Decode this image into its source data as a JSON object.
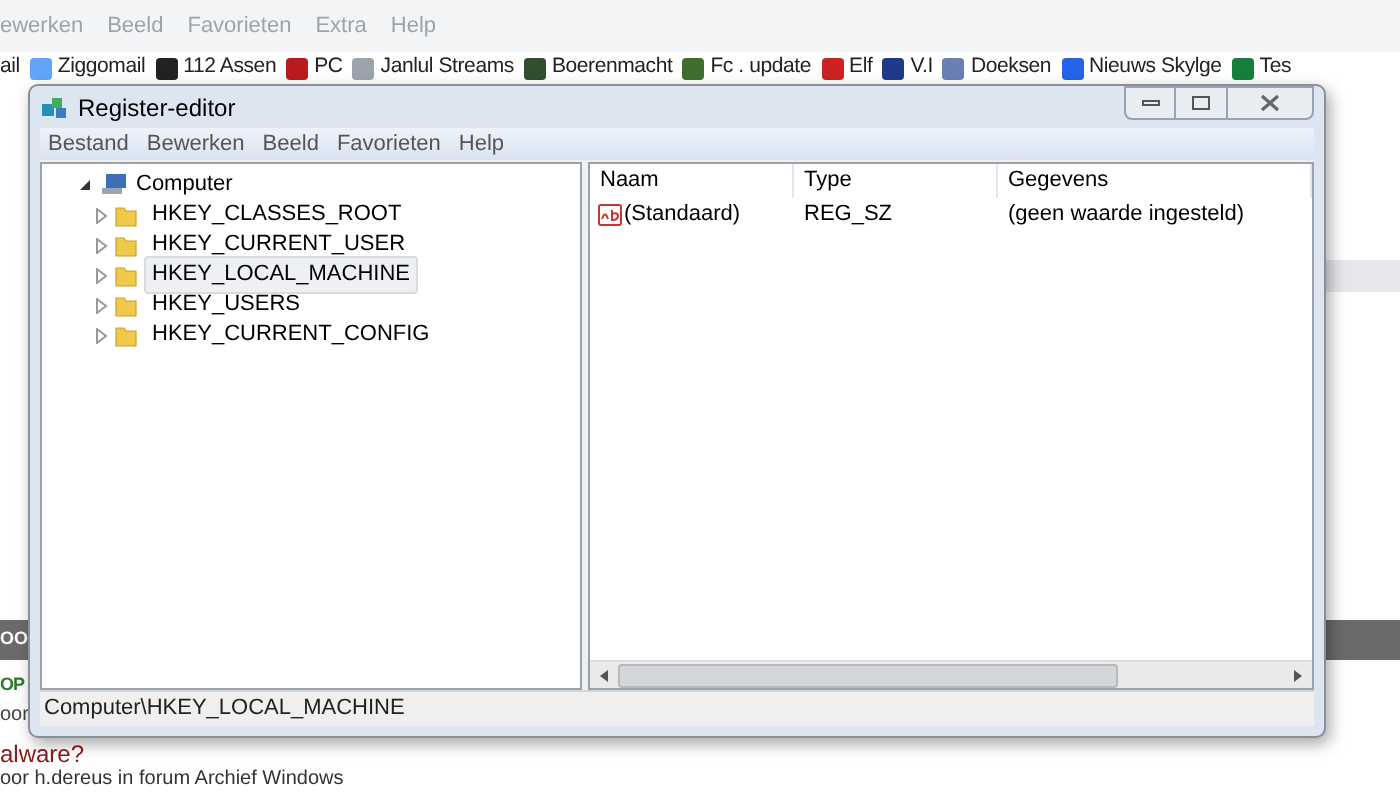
{
  "browser": {
    "menu": [
      "ewerken",
      "Beeld",
      "Favorieten",
      "Extra",
      "Help"
    ],
    "favorites": [
      "ail",
      "Ziggomail",
      "112 Assen",
      "PC",
      "Janlul Streams",
      "Boerenmacht",
      "Fc . update",
      "Elf",
      "V.I",
      "Doeksen",
      "Nieuws Skylge",
      "Tes"
    ],
    "forum": {
      "tag": "OO",
      "heading": "OP",
      "byline": "oor",
      "thread_title": "alware?",
      "thread_byline": "oor h.dereus in forum Archief Windows"
    }
  },
  "window": {
    "title": "Register-editor",
    "menu": [
      "Bestand",
      "Bewerken",
      "Beeld",
      "Favorieten",
      "Help"
    ],
    "tree": {
      "label": "Computer",
      "expanded": true,
      "children": [
        {
          "label": "HKEY_CLASSES_ROOT",
          "selected": false
        },
        {
          "label": "HKEY_CURRENT_USER",
          "selected": false
        },
        {
          "label": "HKEY_LOCAL_MACHINE",
          "selected": true
        },
        {
          "label": "HKEY_USERS",
          "selected": false
        },
        {
          "label": "HKEY_CURRENT_CONFIG",
          "selected": false
        }
      ]
    },
    "list": {
      "columns": [
        "Naam",
        "Type",
        "Gegevens"
      ],
      "rows": [
        {
          "name": "(Standaard)",
          "type": "REG_SZ",
          "data": "(geen waarde ingesteld)"
        }
      ]
    },
    "status_bar": "Computer\\HKEY_LOCAL_MACHINE"
  }
}
